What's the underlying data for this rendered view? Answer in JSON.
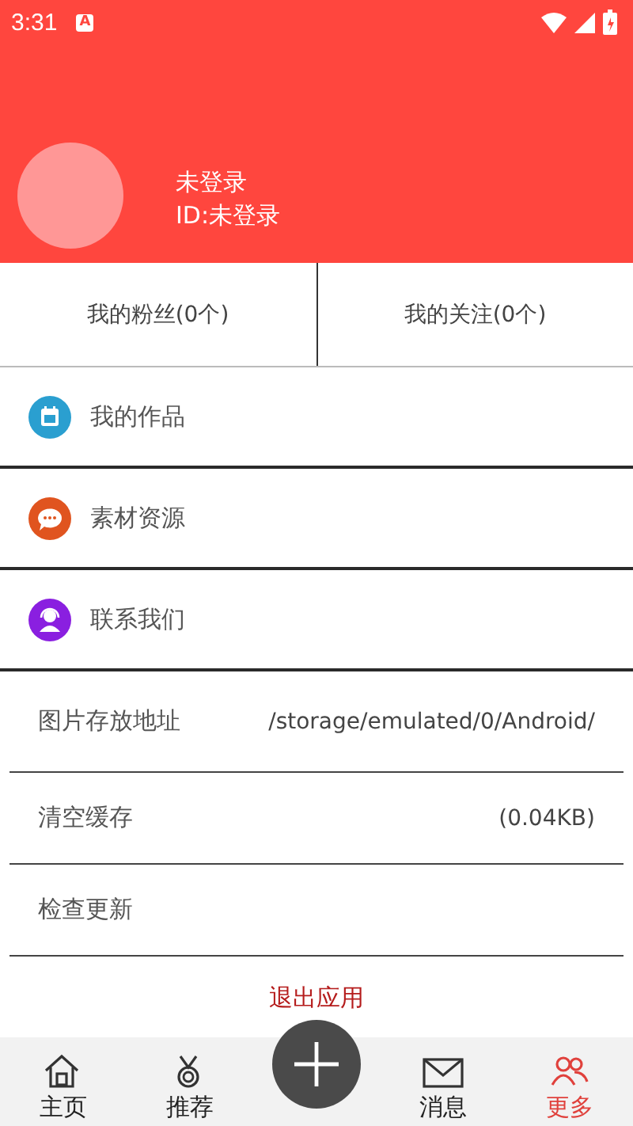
{
  "status_bar": {
    "time": "3:31",
    "notification": "A"
  },
  "profile": {
    "name": "未登录",
    "id": "ID:未登录"
  },
  "stats": [
    {
      "label": "我的粉丝(0个)"
    },
    {
      "label": "我的关注(0个)"
    }
  ],
  "menu": [
    {
      "label": "我的作品",
      "color": "#2a9fd0"
    },
    {
      "label": "素材资源",
      "color": "#e0541f"
    },
    {
      "label": "联系我们",
      "color": "#8a1fe0"
    }
  ],
  "settings": [
    {
      "label": "图片存放地址",
      "value": "/storage/emulated/0/Android/"
    },
    {
      "label": "清空缓存",
      "value": "(0.04KB)"
    },
    {
      "label": "检查更新"
    }
  ],
  "logout": "退出应用",
  "nav": [
    {
      "kind": "tab",
      "label": "主页",
      "selected": false
    },
    {
      "kind": "tab",
      "label": "推荐",
      "selected": false
    },
    {
      "kind": "add"
    },
    {
      "kind": "tab",
      "label": "消息",
      "selected": false
    },
    {
      "kind": "tab",
      "label": "更多",
      "selected": true
    }
  ]
}
